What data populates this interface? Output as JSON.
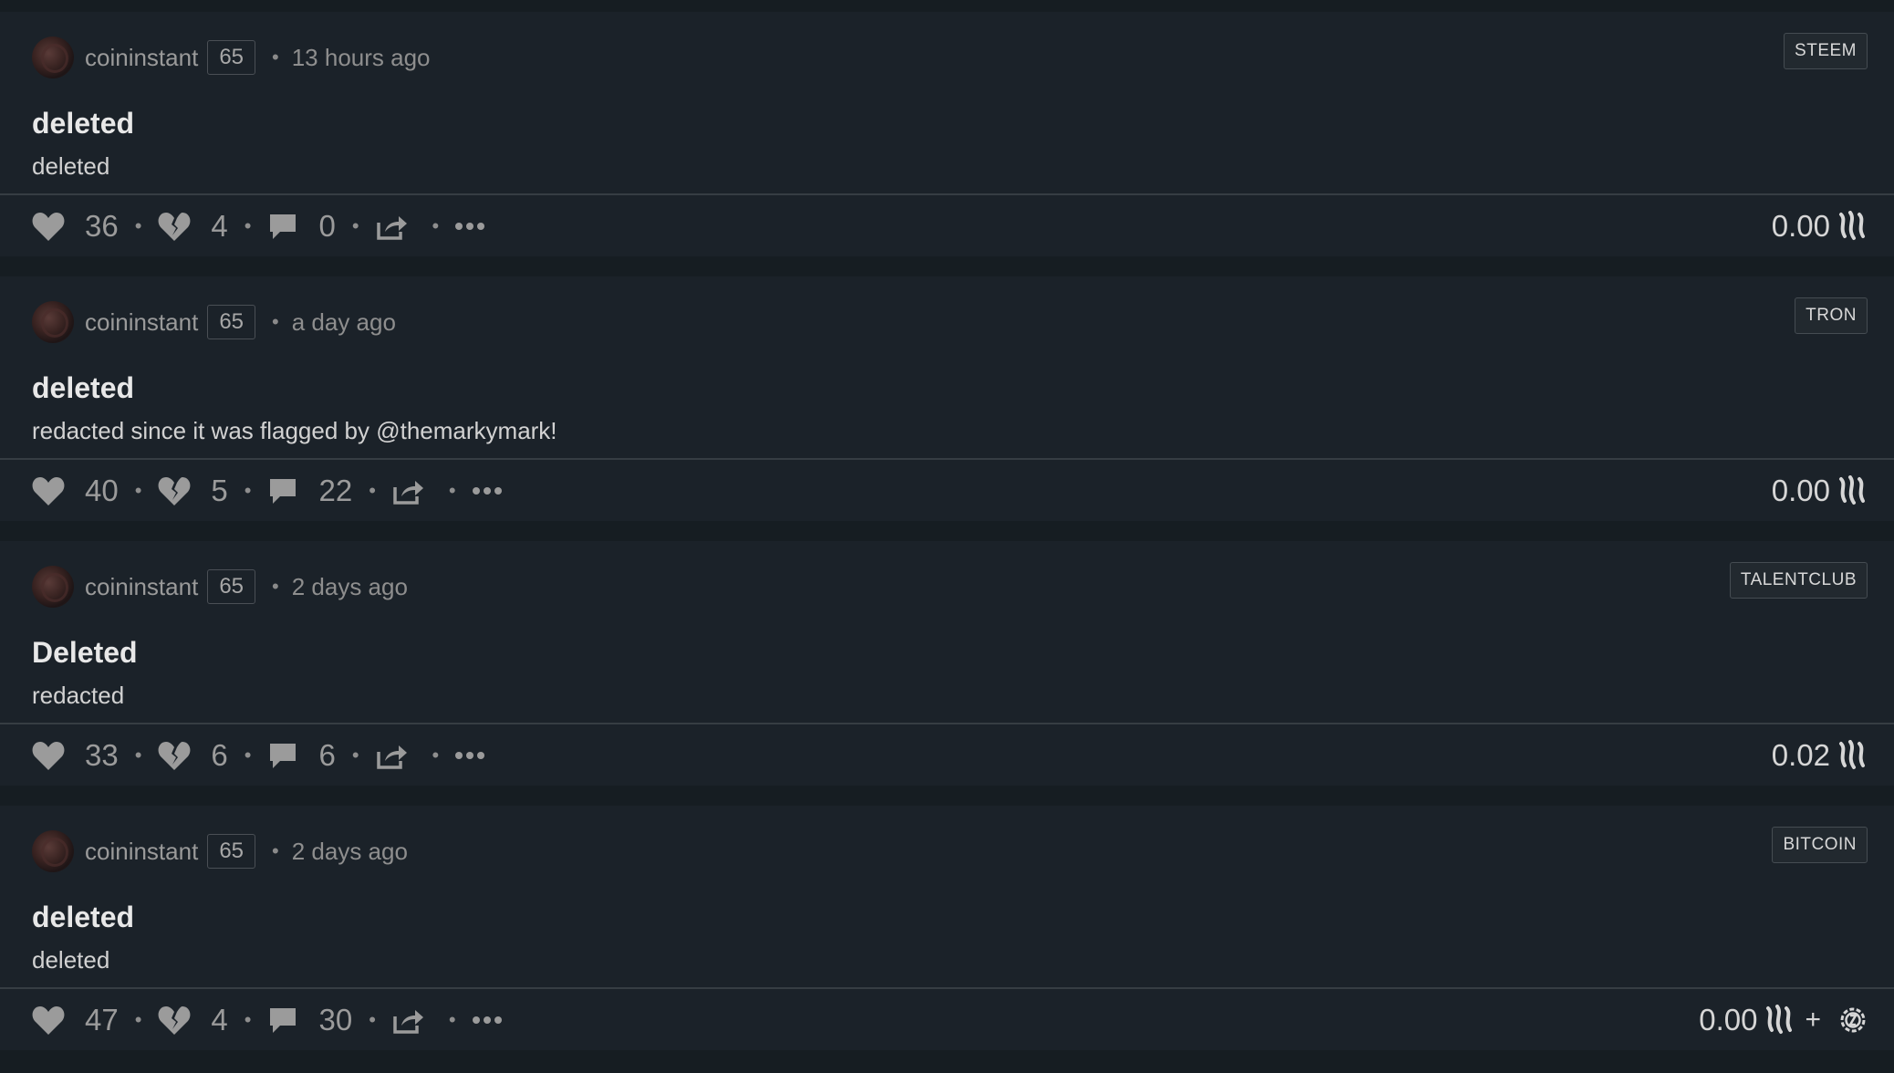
{
  "posts": [
    {
      "author": "coininstant",
      "reputation": "65",
      "time": "13 hours ago",
      "tag": "STEEM",
      "title": "deleted",
      "summary": "deleted",
      "upvotes": "36",
      "downvotes": "4",
      "comments": "0",
      "payout": "0.00",
      "extra_token": false
    },
    {
      "author": "coininstant",
      "reputation": "65",
      "time": "a day ago",
      "tag": "TRON",
      "title": "deleted",
      "summary": "redacted since it was flagged by @themarkymark!",
      "upvotes": "40",
      "downvotes": "5",
      "comments": "22",
      "payout": "0.00",
      "extra_token": false
    },
    {
      "author": "coininstant",
      "reputation": "65",
      "time": "2 days ago",
      "tag": "TALENTCLUB",
      "title": "Deleted",
      "summary": "redacted",
      "upvotes": "33",
      "downvotes": "6",
      "comments": "6",
      "payout": "0.02",
      "extra_token": false
    },
    {
      "author": "coininstant",
      "reputation": "65",
      "time": "2 days ago",
      "tag": "BITCOIN",
      "title": "deleted",
      "summary": "deleted",
      "upvotes": "47",
      "downvotes": "4",
      "comments": "30",
      "payout": "0.00",
      "extra_token": true
    }
  ],
  "separator": "•",
  "plus": "+",
  "icons": {
    "upvote": "heart-icon",
    "downvote": "broken-heart-icon",
    "comment": "comment-icon",
    "share": "share-icon",
    "more": "more-icon",
    "currency": "steem-icon",
    "token": "gear-token-icon"
  },
  "colors": {
    "page_bg": "#161d22",
    "card_bg": "#1b2229",
    "icon_gray": "#9b9b9b",
    "text": "#d2d2d2"
  }
}
